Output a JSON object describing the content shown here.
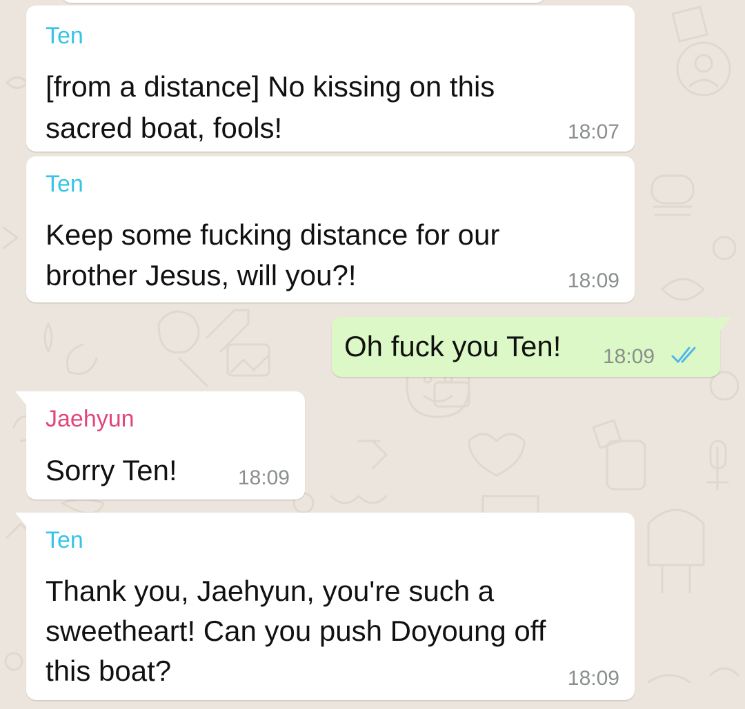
{
  "colors": {
    "background": "#ECE5DD",
    "incoming_bubble": "#FFFFFF",
    "outgoing_bubble": "#DCF8C6",
    "sender_ten": "#35C4E8",
    "sender_jaehyun": "#E2467A",
    "timestamp": "#8A8F8C",
    "read_ticks": "#4FB6EC"
  },
  "messages": [
    {
      "direction": "incoming",
      "sender": "Ten",
      "lines": [
        "[from a distance] No kissing on this",
        "sacred boat, fools!"
      ],
      "time": "18:07"
    },
    {
      "direction": "incoming",
      "sender": "Ten",
      "lines": [
        "Keep some fucking distance for our",
        "brother Jesus, will you?!"
      ],
      "time": "18:09"
    },
    {
      "direction": "outgoing",
      "lines": [
        "Oh fuck you Ten!"
      ],
      "time": "18:09",
      "status_icon": "double-check-read-icon"
    },
    {
      "direction": "incoming",
      "sender": "Jaehyun",
      "lines": [
        "Sorry Ten!"
      ],
      "time": "18:09"
    },
    {
      "direction": "incoming",
      "sender": "Ten",
      "lines": [
        "Thank you, Jaehyun, you're such a",
        "sweetheart! Can you push Doyoung off",
        "this boat?"
      ],
      "time": "18:09"
    }
  ]
}
